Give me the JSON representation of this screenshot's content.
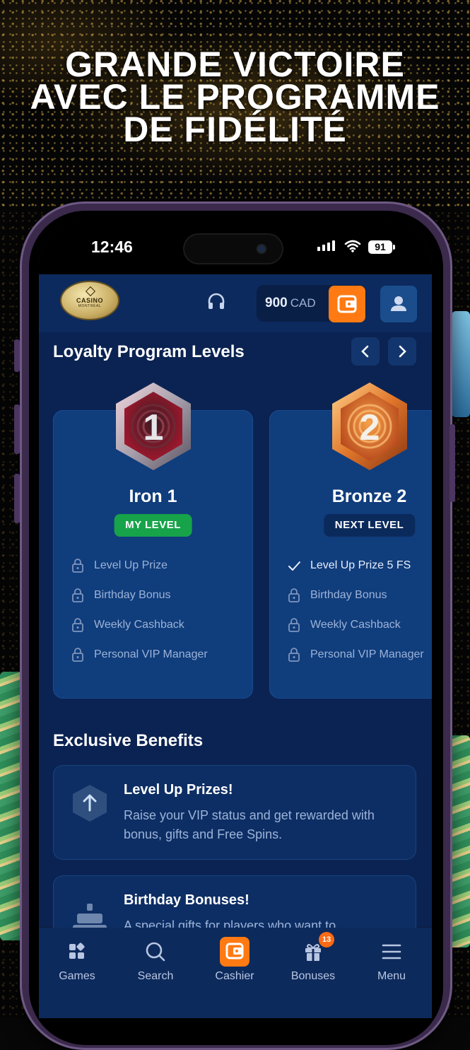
{
  "promo": {
    "headline_lines": [
      "GRANDE VICTOIRE",
      "AVEC LE PROGRAMME",
      "DE FIDÉLITÉ"
    ]
  },
  "status_bar": {
    "time": "12:46",
    "battery": "91"
  },
  "app_header": {
    "logo_text": "CASINO",
    "logo_subtext": "MONTRÉAL",
    "balance_amount": "900",
    "balance_currency": "CAD"
  },
  "loyalty": {
    "title": "Loyalty Program Levels",
    "levels": [
      {
        "number": "1",
        "name": "Iron 1",
        "tag": "MY LEVEL",
        "perks": [
          {
            "label": "Level Up Prize",
            "state": "locked"
          },
          {
            "label": "Birthday Bonus",
            "state": "locked"
          },
          {
            "label": "Weekly Cashback",
            "state": "locked"
          },
          {
            "label": "Personal VIP Manager",
            "state": "locked"
          }
        ]
      },
      {
        "number": "2",
        "name": "Bronze 2",
        "tag": "NEXT LEVEL",
        "perks": [
          {
            "label": "Level Up Prize 5 FS",
            "state": "unlocked"
          },
          {
            "label": "Birthday Bonus",
            "state": "locked"
          },
          {
            "label": "Weekly Cashback",
            "state": "locked"
          },
          {
            "label": "Personal VIP Manager",
            "state": "locked"
          }
        ]
      }
    ]
  },
  "benefits": {
    "title": "Exclusive Benefits",
    "items": [
      {
        "title": "Level Up Prizes!",
        "description": "Raise your VIP status and get rewarded with bonus, gifts and Free Spins."
      },
      {
        "title": "Birthday Bonuses!",
        "description": "A special gifts for players who want to"
      }
    ]
  },
  "bottom_nav": {
    "tabs": [
      {
        "label": "Games",
        "icon": "games-icon"
      },
      {
        "label": "Search",
        "icon": "search-icon"
      },
      {
        "label": "Cashier",
        "icon": "wallet-icon"
      },
      {
        "label": "Bonuses",
        "icon": "gift-icon",
        "badge": "13"
      },
      {
        "label": "Menu",
        "icon": "menu-icon"
      }
    ]
  },
  "colors": {
    "accent_orange": "#ff7a12",
    "my_level_green": "#17a34a",
    "next_level_navy": "#0b2a5c",
    "background_navy": "#0b2352"
  }
}
